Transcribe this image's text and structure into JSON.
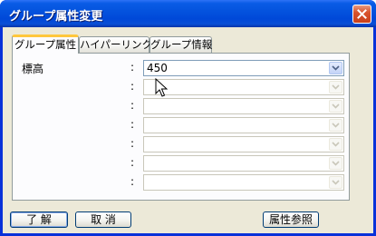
{
  "window": {
    "title": "グループ属性変更",
    "close_icon": "close-icon"
  },
  "tabs": [
    {
      "label": "グループ属性",
      "active": true
    },
    {
      "label": "ハイパーリンク",
      "active": false
    },
    {
      "label": "グループ情報",
      "active": false
    }
  ],
  "attributes": [
    {
      "label": "標高",
      "colon": ":",
      "value": "450",
      "enabled": true
    },
    {
      "label": "",
      "colon": ":",
      "value": "",
      "enabled": false
    },
    {
      "label": "",
      "colon": ":",
      "value": "",
      "enabled": false
    },
    {
      "label": "",
      "colon": ":",
      "value": "",
      "enabled": false
    },
    {
      "label": "",
      "colon": ":",
      "value": "",
      "enabled": false
    },
    {
      "label": "",
      "colon": ":",
      "value": "",
      "enabled": false
    },
    {
      "label": "",
      "colon": ":",
      "value": "",
      "enabled": false
    }
  ],
  "buttons": {
    "ok": "了 解",
    "cancel": "取 消",
    "reference": "属性参照"
  },
  "colors": {
    "titlebar": "#0453de",
    "dialog_bg": "#ece9d8",
    "active_tab_highlight": "#ffc73c",
    "combo_border": "#7f9db9"
  }
}
